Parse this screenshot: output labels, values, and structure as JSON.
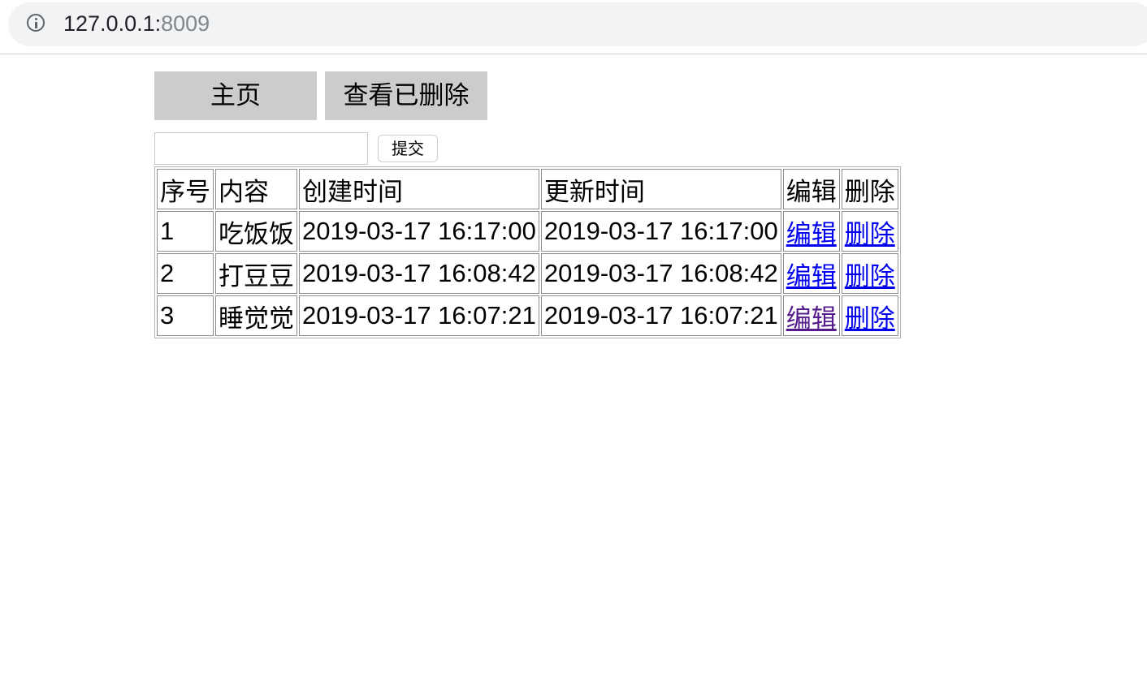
{
  "browser": {
    "url_host": "127.0.0.1:",
    "url_port": "8009"
  },
  "nav": {
    "home_label": "主页",
    "deleted_label": "查看已删除"
  },
  "search": {
    "value": "",
    "submit_label": "提交"
  },
  "table": {
    "headers": [
      "序号",
      "内容",
      "创建时间",
      "更新时间",
      "编辑",
      "删除"
    ],
    "rows": [
      {
        "id": "1",
        "content": "吃饭饭",
        "created": "2019-03-17 16:17:00",
        "updated": "2019-03-17 16:17:00",
        "edit": "编辑",
        "delete": "删除",
        "edit_visited": false
      },
      {
        "id": "2",
        "content": "打豆豆",
        "created": "2019-03-17 16:08:42",
        "updated": "2019-03-17 16:08:42",
        "edit": "编辑",
        "delete": "删除",
        "edit_visited": false
      },
      {
        "id": "3",
        "content": "睡觉觉",
        "created": "2019-03-17 16:07:21",
        "updated": "2019-03-17 16:07:21",
        "edit": "编辑",
        "delete": "删除",
        "edit_visited": true
      }
    ]
  },
  "colors": {
    "link": "#0000ee",
    "link_visited": "#551a8b",
    "nav_button_bg": "#cccccc"
  }
}
